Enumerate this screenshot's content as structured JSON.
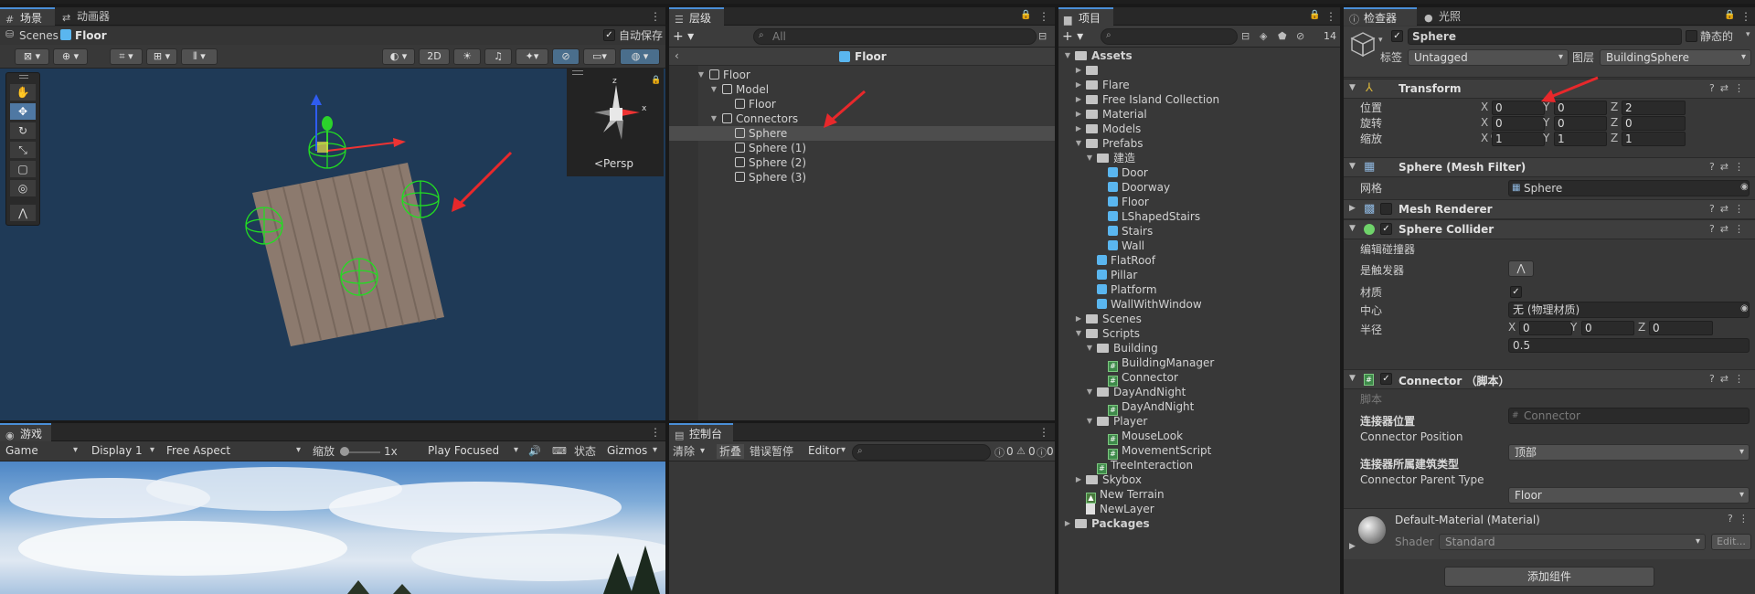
{
  "scene_panel": {
    "tabs": [
      {
        "label": "场景"
      },
      {
        "label": "动画器"
      }
    ],
    "breadcrumb_root": "Scenes",
    "breadcrumb_current": "Floor",
    "autosave_label": "自动保存",
    "autosave_checked": true,
    "toggle_2d": "2D",
    "gizmo_view_label": "<Persp"
  },
  "game_panel": {
    "tab_label": "游戏",
    "display_mode": "Game",
    "display": "Display 1",
    "aspect": "Free Aspect",
    "scale_label": "缩放",
    "scale_value": "1x",
    "play_mode": "Play Focused",
    "stats_label": "状态",
    "gizmos_label": "Gizmos"
  },
  "hierarchy": {
    "tab_label": "层级",
    "search_placeholder": "All",
    "header_title": "Floor",
    "items": [
      {
        "label": "Floor",
        "depth": 0,
        "expanded": true,
        "selected": false
      },
      {
        "label": "Model",
        "depth": 1,
        "expanded": true,
        "selected": false
      },
      {
        "label": "Floor",
        "depth": 2,
        "expanded": false,
        "selected": false
      },
      {
        "label": "Connectors",
        "depth": 1,
        "expanded": true,
        "selected": false
      },
      {
        "label": "Sphere",
        "depth": 2,
        "expanded": false,
        "selected": true
      },
      {
        "label": "Sphere (1)",
        "depth": 2,
        "expanded": false,
        "selected": false
      },
      {
        "label": "Sphere (2)",
        "depth": 2,
        "expanded": false,
        "selected": false
      },
      {
        "label": "Sphere (3)",
        "depth": 2,
        "expanded": false,
        "selected": false
      }
    ]
  },
  "console": {
    "tab_label": "控制台",
    "clear_label": "清除",
    "collapse_label": "折叠",
    "error_pause_label": "错误暂停",
    "editor_label": "Editor",
    "counts": [
      "0",
      "0",
      "0"
    ]
  },
  "project": {
    "tab_label": "项目",
    "hidden_count": "14",
    "items": [
      {
        "label": "Assets",
        "depth": 0,
        "expanded": true,
        "type": "folder",
        "bold": true
      },
      {
        "label": "",
        "depth": 1,
        "expanded": false,
        "type": "folder"
      },
      {
        "label": "Flare",
        "depth": 1,
        "expanded": false,
        "type": "folder"
      },
      {
        "label": "Free Island Collection",
        "depth": 1,
        "expanded": false,
        "type": "folder"
      },
      {
        "label": "Material",
        "depth": 1,
        "expanded": false,
        "type": "folder"
      },
      {
        "label": "Models",
        "depth": 1,
        "expanded": false,
        "type": "folder"
      },
      {
        "label": "Prefabs",
        "depth": 1,
        "expanded": true,
        "type": "folder"
      },
      {
        "label": "建造",
        "depth": 2,
        "expanded": true,
        "type": "folder"
      },
      {
        "label": "Door",
        "depth": 3,
        "expanded": false,
        "type": "prefab"
      },
      {
        "label": "Doorway",
        "depth": 3,
        "expanded": false,
        "type": "prefab"
      },
      {
        "label": "Floor",
        "depth": 3,
        "expanded": false,
        "type": "prefab"
      },
      {
        "label": "LShapedStairs",
        "depth": 3,
        "expanded": false,
        "type": "prefab"
      },
      {
        "label": "Stairs",
        "depth": 3,
        "expanded": false,
        "type": "prefab"
      },
      {
        "label": "Wall",
        "depth": 3,
        "expanded": false,
        "type": "prefab"
      },
      {
        "label": "FlatRoof",
        "depth": 2,
        "expanded": false,
        "type": "prefab"
      },
      {
        "label": "Pillar",
        "depth": 2,
        "expanded": false,
        "type": "prefab"
      },
      {
        "label": "Platform",
        "depth": 2,
        "expanded": false,
        "type": "prefab"
      },
      {
        "label": "WallWithWindow",
        "depth": 2,
        "expanded": false,
        "type": "prefab"
      },
      {
        "label": "Scenes",
        "depth": 1,
        "expanded": false,
        "type": "folder"
      },
      {
        "label": "Scripts",
        "depth": 1,
        "expanded": true,
        "type": "folder"
      },
      {
        "label": "Building",
        "depth": 2,
        "expanded": true,
        "type": "folder"
      },
      {
        "label": "BuildingManager",
        "depth": 3,
        "expanded": false,
        "type": "script"
      },
      {
        "label": "Connector",
        "depth": 3,
        "expanded": false,
        "type": "script"
      },
      {
        "label": "DayAndNight",
        "depth": 2,
        "expanded": true,
        "type": "folder"
      },
      {
        "label": "DayAndNight",
        "depth": 3,
        "expanded": false,
        "type": "script"
      },
      {
        "label": "Player",
        "depth": 2,
        "expanded": true,
        "type": "folder"
      },
      {
        "label": "MouseLook",
        "depth": 3,
        "expanded": false,
        "type": "script"
      },
      {
        "label": "MovementScript",
        "depth": 3,
        "expanded": false,
        "type": "script"
      },
      {
        "label": "TreeInteraction",
        "depth": 2,
        "expanded": false,
        "type": "script"
      },
      {
        "label": "Skybox",
        "depth": 1,
        "expanded": false,
        "type": "folder"
      },
      {
        "label": "New Terrain",
        "depth": 1,
        "expanded": false,
        "type": "terrain"
      },
      {
        "label": "NewLayer",
        "depth": 1,
        "expanded": false,
        "type": "file"
      },
      {
        "label": "Packages",
        "depth": 0,
        "expanded": false,
        "type": "folder",
        "bold": true
      }
    ]
  },
  "inspector": {
    "tabs": [
      {
        "label": "检查器"
      },
      {
        "label": "光照"
      }
    ],
    "object_name": "Sphere",
    "static_label": "静态的",
    "tag_label": "标签",
    "tag_value": "Untagged",
    "layer_label": "图层",
    "layer_value": "BuildingSphere",
    "transform": {
      "title": "Transform",
      "position_label": "位置",
      "rotation_label": "旋转",
      "scale_label": "缩放",
      "position": [
        "0",
        "0",
        "2"
      ],
      "rotation": [
        "0",
        "0",
        "0"
      ],
      "scale": [
        "1",
        "1",
        "1"
      ]
    },
    "mesh_filter": {
      "title": "Sphere (Mesh Filter)",
      "mesh_label": "网格",
      "mesh_value": "Sphere"
    },
    "mesh_renderer": {
      "title": "Mesh Renderer"
    },
    "sphere_collider": {
      "title": "Sphere Collider",
      "edit_label": "编辑碰撞器",
      "trigger_label": "是触发器",
      "material_label": "材质",
      "material_value": "无 (物理材质)",
      "center_label": "中心",
      "center": [
        "0",
        "0",
        "0"
      ],
      "radius_label": "半径",
      "radius_value": "0.5"
    },
    "connector_script": {
      "title": "Connector （脚本）",
      "script_label": "脚本",
      "script_value": "Connector",
      "section1": "连接器位置",
      "position_label": "Connector Position",
      "position_value": "顶部",
      "section2": "连接器所属建筑类型",
      "parent_label": "Connector Parent Type",
      "parent_value": "Floor"
    },
    "material": {
      "title": "Default-Material (Material)",
      "shader_label": "Shader",
      "shader_value": "Standard",
      "edit_label": "Edit..."
    },
    "add_component": "添加组件"
  },
  "colors": {
    "accent": "#4a8fd8",
    "selection": "#2c5d87",
    "annotation_arrow": "#e8282b",
    "prefab_blue": "#5ab6ef"
  }
}
